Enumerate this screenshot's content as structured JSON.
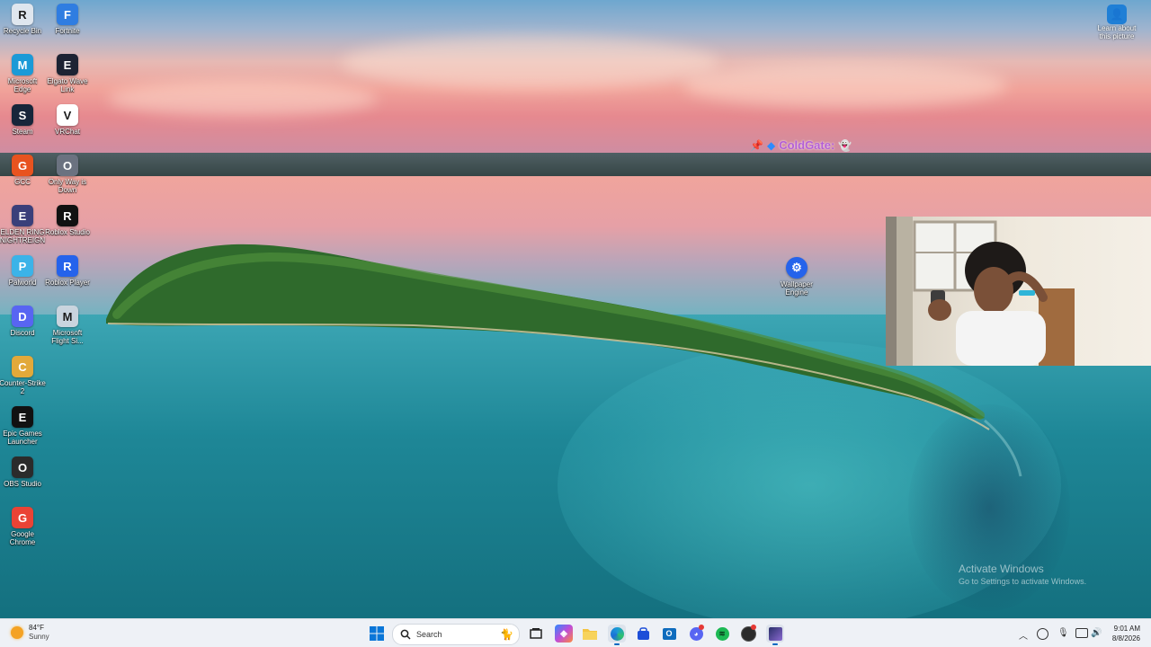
{
  "desktop_icons": [
    {
      "label": "Recycle Bin",
      "icon": "recycle-bin-icon",
      "color": "#dfe6ee"
    },
    {
      "label": "Fortnite",
      "icon": "fortnite-icon",
      "color": "#2f7de1"
    },
    {
      "label": "Microsoft Edge",
      "icon": "edge-icon",
      "color": "#1b9ad7"
    },
    {
      "label": "Elgato Wave Link",
      "icon": "wave-link-icon",
      "color": "#1d2333"
    },
    {
      "label": "Steam",
      "icon": "steam-icon",
      "color": "#17253a"
    },
    {
      "label": "VRChat",
      "icon": "vrchat-icon",
      "color": "#ffffff"
    },
    {
      "label": "GCC",
      "icon": "gcc-icon",
      "color": "#e8531f"
    },
    {
      "label": "Only Way is Down",
      "icon": "game-icon",
      "color": "#6b7280"
    },
    {
      "label": "ELDEN RING NIGHTREIGN",
      "icon": "elden-ring-icon",
      "color": "#3a3f7a"
    },
    {
      "label": "Roblox Studio",
      "icon": "roblox-studio-icon",
      "color": "#111111"
    },
    {
      "label": "Palworld",
      "icon": "palworld-icon",
      "color": "#3bb3e8"
    },
    {
      "label": "Roblox Player",
      "icon": "roblox-player-icon",
      "color": "#2563eb"
    },
    {
      "label": "Discord",
      "icon": "discord-icon",
      "color": "#5865f2"
    },
    {
      "label": "Microsoft Flight Si...",
      "icon": "flight-sim-icon",
      "color": "#c9d4de"
    },
    {
      "label": "Counter-Strike 2",
      "icon": "counter-strike-icon",
      "color": "#e2a93a"
    },
    {
      "label": "Epic Games Launcher",
      "icon": "epic-games-icon",
      "color": "#111111"
    },
    {
      "label": "OBS Studio",
      "icon": "obs-icon",
      "color": "#2b2b2b"
    },
    {
      "label": "Google Chrome",
      "icon": "chrome-icon",
      "color": "#ea4335"
    }
  ],
  "wallpaper_engine": {
    "label": "Wallpaper Engine",
    "icon": "wallpaper-engine-icon",
    "color": "#2563eb"
  },
  "learn_picture": {
    "label": "Learn about this picture",
    "icon": "learn-picture-icon"
  },
  "overlay": {
    "text": "ColdGate:",
    "color": "#b45fd6"
  },
  "activation": {
    "title": "Activate Windows",
    "subtitle": "Go to Settings to activate Windows."
  },
  "taskbar": {
    "weather": {
      "temp": "84°F",
      "condition": "Sunny"
    },
    "search_label": "Search",
    "pinned": [
      {
        "name": "start-button",
        "icon": "windows-logo-icon"
      },
      {
        "name": "task-view-button",
        "icon": "task-view-icon"
      },
      {
        "name": "copilot-button",
        "icon": "copilot-icon"
      },
      {
        "name": "file-explorer-button",
        "icon": "folder-icon"
      },
      {
        "name": "edge-taskbar-button",
        "icon": "edge-icon"
      },
      {
        "name": "store-button",
        "icon": "store-icon"
      },
      {
        "name": "outlook-button",
        "icon": "outlook-icon"
      },
      {
        "name": "discord-taskbar-button",
        "icon": "discord-icon"
      },
      {
        "name": "spotify-button",
        "icon": "spotify-icon"
      },
      {
        "name": "obs-taskbar-button",
        "icon": "obs-icon"
      },
      {
        "name": "elden-ring-taskbar-button",
        "icon": "game-icon"
      }
    ],
    "clock": {
      "time": "9:01 AM",
      "date": "8/8/2026"
    }
  }
}
